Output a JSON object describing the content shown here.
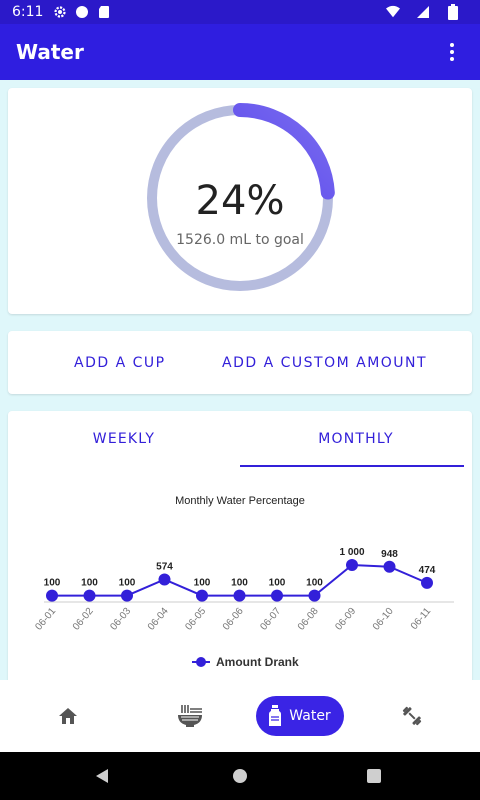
{
  "status_bar": {
    "time": "6:11"
  },
  "app_bar": {
    "title": "Water"
  },
  "progress": {
    "percent_text": "24%",
    "goal_text": "1526.0 mL to goal",
    "fraction": 0.24
  },
  "actions": {
    "add_cup": "ADD A CUP",
    "add_custom": "ADD A CUSTOM AMOUNT"
  },
  "tabs": [
    {
      "label": "WEEKLY",
      "active": false
    },
    {
      "label": "MONTHLY",
      "active": true
    }
  ],
  "chart_data": {
    "type": "line",
    "title": "Monthly Water Percentage",
    "x": [
      "06-01",
      "06-02",
      "06-03",
      "06-04",
      "06-05",
      "06-06",
      "06-07",
      "06-08",
      "06-09",
      "06-10",
      "06-11"
    ],
    "series": [
      {
        "name": "Amount Drank",
        "values": [
          100,
          100,
          100,
          574,
          100,
          100,
          100,
          100,
          1000,
          948,
          474
        ]
      }
    ],
    "labels": [
      "100",
      "100",
      "100",
      "574",
      "100",
      "100",
      "100",
      "100",
      "1 000",
      "948",
      "474"
    ],
    "ylim": [
      0,
      1000
    ],
    "legend": "bottom-center"
  },
  "bottom_nav": {
    "water_label": "Water"
  },
  "colors": {
    "accent": "#3320d9",
    "appbar": "#2f1ee0",
    "ring_track": "#b6bcde"
  },
  "icons": {
    "home": "home-icon",
    "food": "ramen-icon",
    "water": "bottle-icon",
    "fitness": "dumbbell-icon"
  }
}
